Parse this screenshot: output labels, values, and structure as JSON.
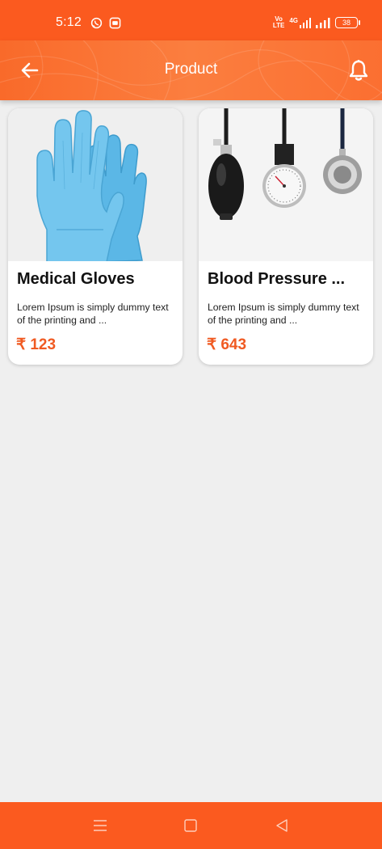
{
  "status_bar": {
    "time": "5:12",
    "left_icons": [
      "whatsapp-icon",
      "message-app-icon"
    ],
    "network_label_top": "Vo",
    "network_label_bottom": "LTE",
    "network_type": "4G",
    "battery_level": "38"
  },
  "app_bar": {
    "title": "Product",
    "back_icon": "arrow-left-icon",
    "bell_icon": "bell-icon"
  },
  "colors": {
    "primary": "#fb5a1f",
    "price": "#f05a22",
    "background": "#efefef"
  },
  "products": [
    {
      "title": "Medical Gloves",
      "description": "Lorem Ipsum is simply dummy text of the printing and ...",
      "price": "₹ 123",
      "image": "blue-medical-gloves"
    },
    {
      "title": "Blood Pressure ...",
      "description": "Lorem Ipsum is simply dummy text of the printing and ...",
      "price": "₹ 643",
      "image": "sphygmomanometer-and-stethoscope"
    }
  ],
  "nav_bar": {
    "icons": [
      "menu-icon",
      "home-square-icon",
      "back-triangle-icon"
    ]
  }
}
